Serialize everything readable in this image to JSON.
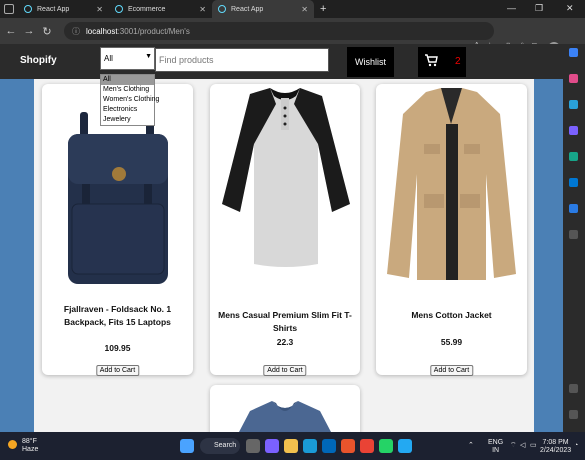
{
  "browser": {
    "tabs": [
      {
        "title": "React App",
        "icon": "react-icon"
      },
      {
        "title": "Ecommerce",
        "icon": "react-icon"
      },
      {
        "title": "React App",
        "icon": "react-icon",
        "active": true
      }
    ],
    "address": {
      "host": "localhost",
      "path": ":3001/product/Men's"
    }
  },
  "navbar": {
    "brand": "Shopify",
    "category_selected": "All",
    "category_options": [
      "All",
      "Men's Clothing",
      "Women's Clothing",
      "Electronics",
      "Jewelery"
    ],
    "search_placeholder": "Find products",
    "wishlist_label": "Wishlist",
    "cart_count": "2"
  },
  "products": [
    {
      "title": "Fjallraven - Foldsack No. 1 Backpack, Fits 15 Laptops",
      "price": "109.95",
      "button": "Add to Cart",
      "image": "backpack"
    },
    {
      "title": "Mens Casual Premium Slim Fit T-Shirts",
      "price": "22.3",
      "button": "Add to Cart",
      "image": "raglan-tshirt"
    },
    {
      "title": "Mens Cotton Jacket",
      "price": "55.99",
      "button": "Add to Cart",
      "image": "jacket"
    },
    {
      "title": "",
      "price": "",
      "button": "",
      "image": "blue-tshirt"
    }
  ],
  "taskbar": {
    "weather_temp": "88°F",
    "weather_desc": "Haze",
    "search_label": "Search",
    "lang": "ENG",
    "region": "IN",
    "time": "7:08 PM",
    "date": "2/24/2023"
  },
  "colors": {
    "page_bg": "#4b80b5",
    "navbar_bg": "#2b2b2b",
    "cart_count": "#ee0000"
  }
}
